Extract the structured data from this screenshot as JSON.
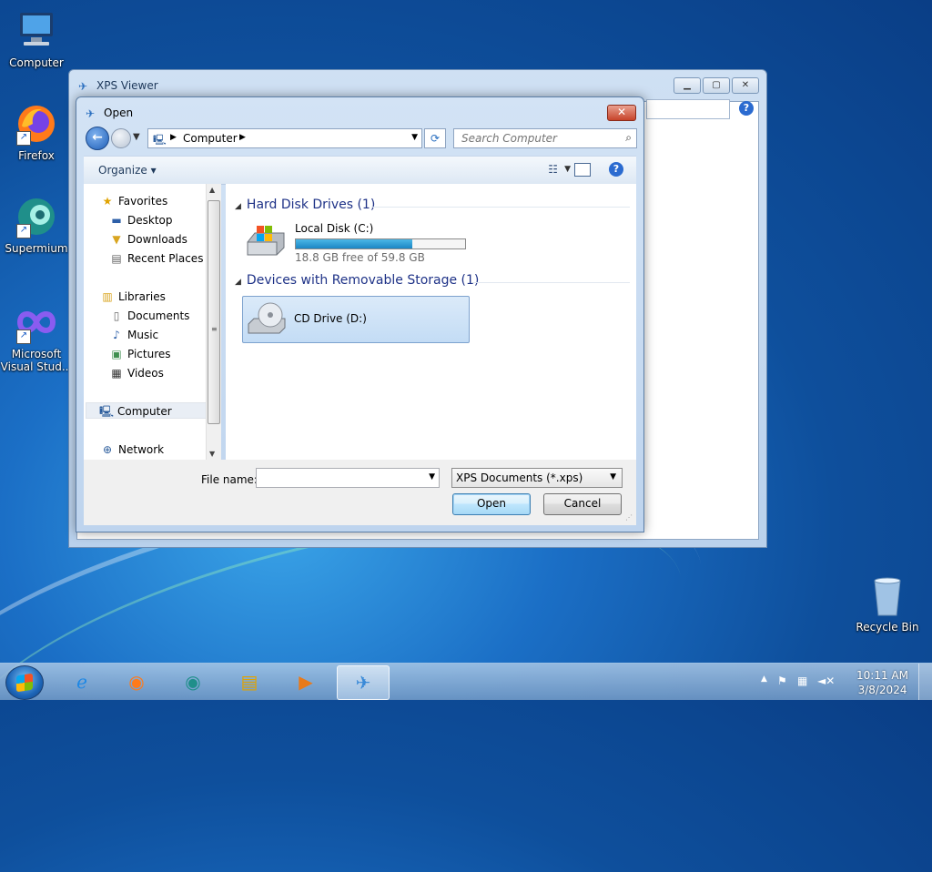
{
  "desktop": {
    "icons": [
      {
        "label": "Computer"
      },
      {
        "label": "Firefox"
      },
      {
        "label": "Supermium"
      },
      {
        "label": "Microsoft Visual Stud..."
      }
    ],
    "recycle_bin": "Recycle Bin"
  },
  "xps_window": {
    "title": "XPS Viewer"
  },
  "dialog": {
    "title": "Open",
    "address": "Computer",
    "search_placeholder": "Search Computer",
    "toolbar": {
      "organize": "Organize"
    },
    "nav": {
      "favorites": "Favorites",
      "desktop": "Desktop",
      "downloads": "Downloads",
      "recent": "Recent Places",
      "libraries": "Libraries",
      "documents": "Documents",
      "music": "Music",
      "pictures": "Pictures",
      "videos": "Videos",
      "computer": "Computer",
      "network": "Network"
    },
    "groups": {
      "hdd": "Hard Disk Drives (1)",
      "removable": "Devices with Removable Storage (1)"
    },
    "drives": {
      "c_name": "Local Disk (C:)",
      "c_free": "18.8 GB free of 59.8 GB",
      "c_used_fraction": 0.686,
      "d_name": "CD Drive (D:)"
    },
    "bottom": {
      "file_name_label": "File name:",
      "file_name_value": "",
      "filter": "XPS Documents (*.xps)",
      "open": "Open",
      "cancel": "Cancel"
    }
  },
  "taskbar": {
    "time": "10:11 AM",
    "date": "3/8/2024"
  },
  "colors": {
    "accent": "#2b6bd0",
    "selection": "#c3dcf5",
    "bar_fill": "#1b86c4"
  }
}
